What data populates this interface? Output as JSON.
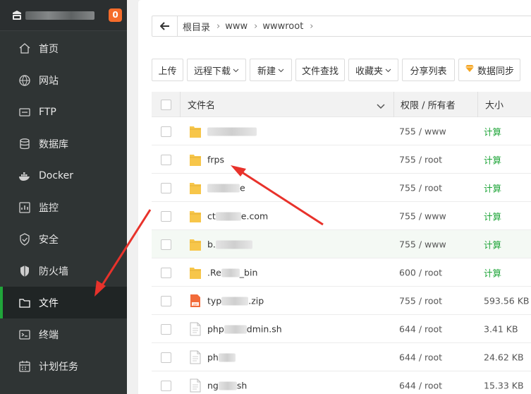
{
  "sidebar": {
    "badge": "0",
    "items": [
      {
        "label": "首页",
        "icon": "home-icon"
      },
      {
        "label": "网站",
        "icon": "globe-icon"
      },
      {
        "label": "FTP",
        "icon": "ftp-icon"
      },
      {
        "label": "数据库",
        "icon": "database-icon"
      },
      {
        "label": "Docker",
        "icon": "docker-icon"
      },
      {
        "label": "监控",
        "icon": "monitor-icon"
      },
      {
        "label": "安全",
        "icon": "shield-icon"
      },
      {
        "label": "防火墙",
        "icon": "firewall-icon"
      },
      {
        "label": "文件",
        "icon": "folder-icon"
      },
      {
        "label": "终端",
        "icon": "terminal-icon"
      },
      {
        "label": "计划任务",
        "icon": "calendar-icon"
      }
    ],
    "active_index": 8
  },
  "path": {
    "crumbs": [
      "根目录",
      "www",
      "wwwroot"
    ]
  },
  "toolbar": {
    "upload": "上传",
    "remote_download": "远程下载",
    "new": "新建",
    "find": "文件查找",
    "favorites": "收藏夹",
    "share_list": "分享列表",
    "sync": "数据同步"
  },
  "table": {
    "headers": {
      "name": "文件名",
      "perm": "权限 / 所有者",
      "size": "大小"
    },
    "rows": [
      {
        "name_pre": "",
        "name_post": "",
        "type": "folder",
        "perm": "755 / www",
        "size": "计算"
      },
      {
        "name_pre": "frps",
        "name_post": "",
        "type": "folder",
        "perm": "755 / root",
        "size": "计算"
      },
      {
        "name_pre": "",
        "name_post": "e",
        "type": "folder",
        "perm": "755 / root",
        "size": "计算"
      },
      {
        "name_pre": "ct",
        "name_post": "e.com",
        "type": "folder",
        "perm": "755 / www",
        "size": "计算"
      },
      {
        "name_pre": "b.",
        "name_post": "",
        "type": "folder",
        "perm": "755 / www",
        "size": "计算"
      },
      {
        "name_pre": ".Re",
        "name_post": "_bin",
        "type": "folder",
        "perm": "600 / root",
        "size": "计算"
      },
      {
        "name_pre": "typ",
        "name_post": ".zip",
        "type": "zip",
        "perm": "755 / root",
        "size": "593.56 KB"
      },
      {
        "name_pre": "php",
        "name_post": "dmin.sh",
        "type": "file",
        "perm": "644 / root",
        "size": "3.41 KB"
      },
      {
        "name_pre": "ph",
        "name_post": "",
        "type": "file",
        "perm": "644 / root",
        "size": "24.62 KB"
      },
      {
        "name_pre": "ng",
        "name_post": "sh",
        "type": "file",
        "perm": "644 / root",
        "size": "15.33 KB"
      }
    ]
  },
  "colors": {
    "accent": "#20a53a",
    "badge": "#f56c2b",
    "annotation": "#e8322b",
    "folder": "#f7c64a"
  }
}
